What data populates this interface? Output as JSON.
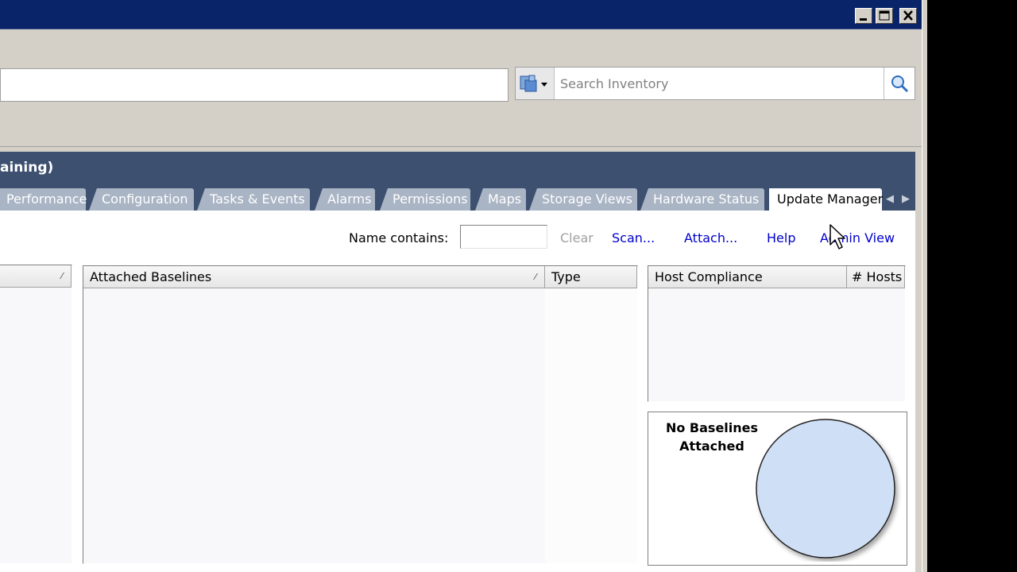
{
  "window": {
    "buttons": [
      {
        "name": "minimize",
        "glyph": "▁"
      },
      {
        "name": "maximize",
        "glyph": "□"
      },
      {
        "name": "close",
        "glyph": "✕"
      }
    ]
  },
  "search": {
    "placeholder": "Search Inventory"
  },
  "object_header": {
    "title": "aining)"
  },
  "tabs": [
    {
      "label": "Performance",
      "active": false
    },
    {
      "label": "Configuration",
      "active": false
    },
    {
      "label": "Tasks & Events",
      "active": false
    },
    {
      "label": "Alarms",
      "active": false
    },
    {
      "label": "Permissions",
      "active": false
    },
    {
      "label": "Maps",
      "active": false
    },
    {
      "label": "Storage Views",
      "active": false
    },
    {
      "label": "Hardware Status",
      "active": false
    },
    {
      "label": "Update Manager",
      "active": true
    }
  ],
  "toolbar": {
    "name_contains_label": "Name contains:",
    "name_contains_value": "",
    "clear_label": "Clear",
    "scan_label": "Scan...",
    "attach_label": "Attach...",
    "help_label": "Help",
    "admin_view_label": "Admin View"
  },
  "baselines_table": {
    "columns": [
      "Attached Baselines",
      "Type"
    ]
  },
  "compliance_table": {
    "columns": [
      "Host Compliance",
      "# Hosts"
    ]
  },
  "compliance_chart": {
    "caption_line1": "No Baselines",
    "caption_line2": "Attached",
    "fill_color": "#cfdff5"
  },
  "colors": {
    "titlebar": "#0a246a",
    "header": "#3d5070",
    "link": "#0000cc"
  }
}
